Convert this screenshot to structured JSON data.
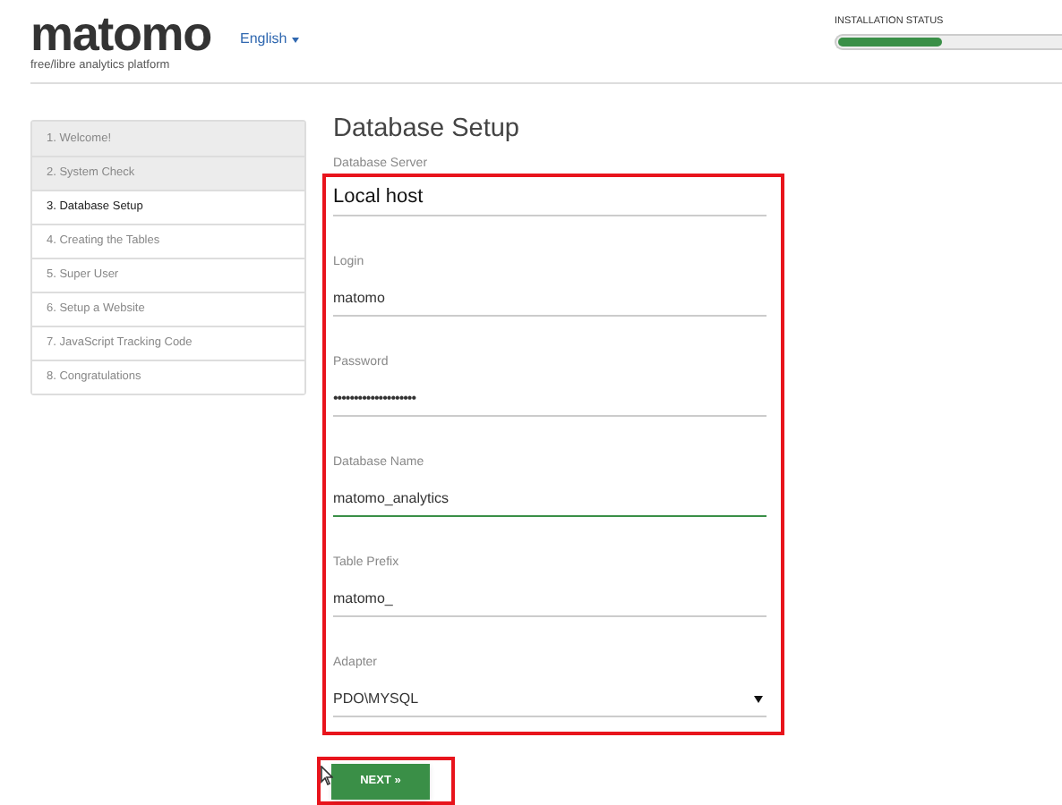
{
  "header": {
    "logo": "matomo",
    "tagline": "free/libre analytics platform",
    "language": "English"
  },
  "installation_status": {
    "label": "INSTALLATION STATUS",
    "level": 0.47
  },
  "steps": [
    {
      "label": "1. Welcome!",
      "completed": true,
      "selected": false
    },
    {
      "label": "2. System Check",
      "completed": true,
      "selected": false
    },
    {
      "label": "3. Database Setup",
      "completed": false,
      "selected": true
    },
    {
      "label": "4. Creating the Tables",
      "completed": false,
      "selected": false
    },
    {
      "label": "5. Super User",
      "completed": false,
      "selected": false
    },
    {
      "label": "6. Setup a Website",
      "completed": false,
      "selected": false
    },
    {
      "label": "7. JavaScript Tracking Code",
      "completed": false,
      "selected": false
    },
    {
      "label": "8. Congratulations",
      "completed": false,
      "selected": false
    }
  ],
  "title": "Database Setup",
  "fields": [
    {
      "label": "Database Server",
      "value": "Local host",
      "kind": "text",
      "large": true,
      "focused": false
    },
    {
      "label": "Login",
      "value": "matomo",
      "kind": "text",
      "large": false,
      "focused": false
    },
    {
      "label": "Password",
      "value": "••••••••••••••••••••",
      "kind": "password",
      "large": false,
      "focused": false
    },
    {
      "label": "Database Name",
      "value": "matomo_analytics",
      "kind": "text",
      "large": false,
      "focused": true
    },
    {
      "label": "Table Prefix",
      "value": "matomo_",
      "kind": "text",
      "large": false,
      "focused": false
    },
    {
      "label": "Adapter",
      "value": "PDO\\MYSQL",
      "kind": "select",
      "large": false,
      "focused": false
    }
  ],
  "next_button": "NEXT »"
}
